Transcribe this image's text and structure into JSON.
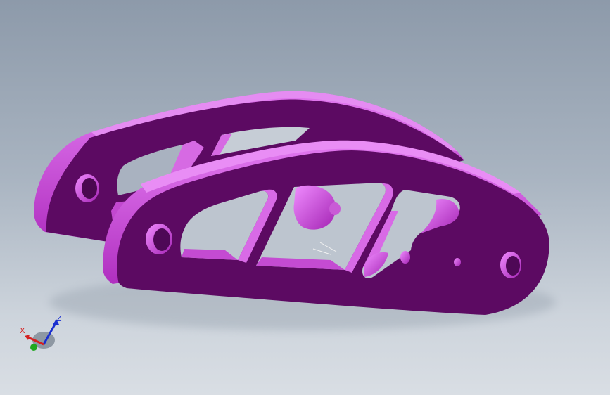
{
  "viewport": {
    "background_top": "#8d9aaa",
    "background_bottom": "#d9dee4"
  },
  "model": {
    "part_face_color": "#5c0a62",
    "part_edge_color": "#c33cd0",
    "part_highlight_color": "#e06bee"
  },
  "triad": {
    "x_label": "X",
    "z_label": "Z",
    "x_color": "#d42020",
    "y_color": "#1fa81f",
    "z_color": "#1a2fd0"
  }
}
